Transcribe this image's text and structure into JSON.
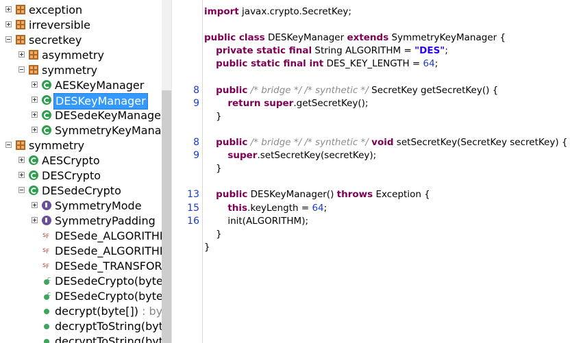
{
  "tree": {
    "nodes": [
      {
        "label": "exception",
        "expander": "plus",
        "icon": "package"
      },
      {
        "label": "irreversible",
        "expander": "plus",
        "icon": "package"
      },
      {
        "label": "secretkey",
        "expander": "minus",
        "icon": "package"
      },
      {
        "label": "asymmetry",
        "expander": "plus",
        "icon": "package"
      },
      {
        "label": "symmetry",
        "expander": "minus",
        "icon": "package"
      },
      {
        "label": "AESKeyManager",
        "expander": "plus",
        "icon": "class"
      },
      {
        "label": "DESKeyManager",
        "expander": "plus",
        "icon": "class",
        "selected": true
      },
      {
        "label": "DESedeKeyManager",
        "expander": "plus",
        "icon": "class"
      },
      {
        "label": "SymmetryKeyManag",
        "expander": "plus",
        "icon": "abstract-class"
      },
      {
        "label": "symmetry",
        "expander": "minus",
        "icon": "package"
      },
      {
        "label": "AESCrypto",
        "expander": "plus",
        "icon": "class"
      },
      {
        "label": "DESCrypto",
        "expander": "plus",
        "icon": "class"
      },
      {
        "label": "DESedeCrypto",
        "expander": "minus",
        "icon": "class"
      },
      {
        "label": "SymmetryMode",
        "expander": "plus",
        "icon": "enum"
      },
      {
        "label": "SymmetryPadding",
        "expander": "plus",
        "icon": "enum"
      },
      {
        "label": "DESede_ALGORITHM",
        "expander": "none",
        "icon": "static-final-field"
      },
      {
        "label": "DESede_ALGORITHM",
        "expander": "none",
        "icon": "static-final-field"
      },
      {
        "label": "DESede_TRANSFORM",
        "expander": "none",
        "icon": "static-final-field"
      },
      {
        "label": "DESedeCrypto(byte[]",
        "expander": "none",
        "icon": "constructor"
      },
      {
        "label": "DESedeCrypto(byte[]",
        "expander": "none",
        "icon": "constructor"
      },
      {
        "label": "decrypt(byte[])",
        "suffix": " : byte",
        "expander": "none",
        "icon": "method"
      },
      {
        "label": "decryptToString(byte",
        "expander": "none",
        "icon": "method"
      },
      {
        "label": "decryptToString(byte",
        "expander": "none",
        "icon": "method"
      }
    ]
  },
  "editor": {
    "lines": [
      {
        "num": "",
        "code": [
          [
            "kw",
            "import"
          ],
          [
            "t",
            " javax.crypto.SecretKey;"
          ]
        ]
      },
      {
        "num": "",
        "code": []
      },
      {
        "num": "",
        "code": [
          [
            "kw",
            "public class"
          ],
          [
            "t",
            " DESKeyManager "
          ],
          [
            "kw",
            "extends"
          ],
          [
            "t",
            " SymmetryKeyManager {"
          ]
        ]
      },
      {
        "num": "",
        "code": [
          [
            "t",
            "    "
          ],
          [
            "kw",
            "private static final"
          ],
          [
            "t",
            " String ALGORITHM = "
          ],
          [
            "str",
            "\"DES\""
          ],
          [
            "t",
            ";"
          ]
        ]
      },
      {
        "num": "",
        "code": [
          [
            "t",
            "    "
          ],
          [
            "kw",
            "public static final int"
          ],
          [
            "t",
            " DES_KEY_LENGTH = "
          ],
          [
            "num",
            "64"
          ],
          [
            "t",
            ";"
          ]
        ]
      },
      {
        "num": "",
        "code": []
      },
      {
        "num": "8",
        "code": [
          [
            "t",
            "    "
          ],
          [
            "kw",
            "public"
          ],
          [
            "t",
            " "
          ],
          [
            "cmt",
            "/* bridge */ /* synthetic */"
          ],
          [
            "t",
            " SecretKey getSecretKey() {"
          ]
        ]
      },
      {
        "num": "9",
        "code": [
          [
            "t",
            "        "
          ],
          [
            "kw",
            "return super"
          ],
          [
            "t",
            ".getSecretKey();"
          ]
        ]
      },
      {
        "num": "",
        "code": [
          [
            "t",
            "    }"
          ]
        ]
      },
      {
        "num": "",
        "code": []
      },
      {
        "num": "8",
        "code": [
          [
            "t",
            "    "
          ],
          [
            "kw",
            "public"
          ],
          [
            "t",
            " "
          ],
          [
            "cmt",
            "/* bridge */ /* synthetic */"
          ],
          [
            "t",
            " "
          ],
          [
            "kw",
            "void"
          ],
          [
            "t",
            " setSecretKey(SecretKey secretKey) {"
          ]
        ]
      },
      {
        "num": "9",
        "code": [
          [
            "t",
            "        "
          ],
          [
            "kw",
            "super"
          ],
          [
            "t",
            ".setSecretKey(secretKey);"
          ]
        ]
      },
      {
        "num": "",
        "code": [
          [
            "t",
            "    }"
          ]
        ]
      },
      {
        "num": "",
        "code": []
      },
      {
        "num": "13",
        "code": [
          [
            "t",
            "    "
          ],
          [
            "kw",
            "public"
          ],
          [
            "t",
            " DESKeyManager() "
          ],
          [
            "kw",
            "throws"
          ],
          [
            "t",
            " Exception {"
          ]
        ]
      },
      {
        "num": "15",
        "code": [
          [
            "t",
            "        "
          ],
          [
            "kw",
            "this"
          ],
          [
            "t",
            ".keyLength = "
          ],
          [
            "num",
            "64"
          ],
          [
            "t",
            ";"
          ]
        ]
      },
      {
        "num": "16",
        "code": [
          [
            "t",
            "        init(ALGORITHM);"
          ]
        ]
      },
      {
        "num": "",
        "code": [
          [
            "t",
            "    }"
          ]
        ]
      },
      {
        "num": "",
        "code": [
          [
            "t",
            "}"
          ]
        ]
      }
    ]
  }
}
